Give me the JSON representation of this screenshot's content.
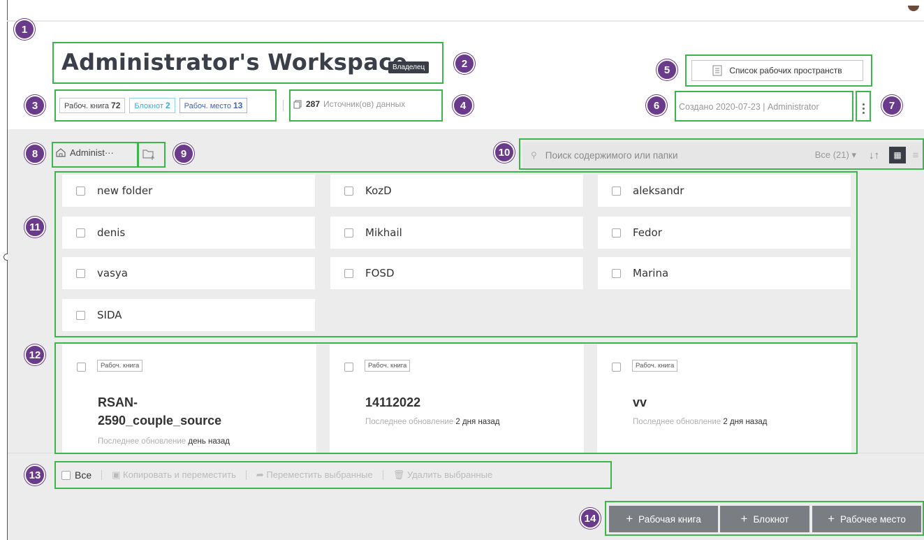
{
  "markers": [
    "1",
    "2",
    "3",
    "4",
    "5",
    "6",
    "7",
    "8",
    "9",
    "10",
    "11",
    "12",
    "13",
    "14"
  ],
  "header": {
    "title": "Administrator's Workspace",
    "owner_badge": "Владелец",
    "counts": [
      {
        "label": "Рабоч. книга",
        "value": "72"
      },
      {
        "label": "Блокнот",
        "value": "2"
      },
      {
        "label": "Рабоч. место",
        "value": "13"
      }
    ],
    "sources_count": "287",
    "sources_label": "Источник(ов) данных",
    "workspace_list_label": "Список рабочих пространств",
    "created_text": "Создано 2020-07-23 | Administrator"
  },
  "toolbar": {
    "breadcrumb": "Administ···",
    "search_placeholder": "Поиск содержимого или папки",
    "filter_label": "Все (21)",
    "filter_caret": "▾",
    "sort_icon": "↓↑",
    "grid_icon": "▦",
    "list_icon": "≡"
  },
  "folders": [
    "new folder",
    "KozD",
    "aleksandr",
    "denis",
    "Mikhail",
    "Fedor",
    "vasya",
    "FOSD",
    "Marina",
    "SIDA"
  ],
  "cards": [
    {
      "type": "Рабоч. книга",
      "name": "RSAN-2590_couple_source",
      "updated_label": "Последнее обновление",
      "updated_value": "день назад"
    },
    {
      "type": "Рабоч. книга",
      "name": "14112022",
      "updated_label": "Последнее обновление",
      "updated_value": "2 дня назад"
    },
    {
      "type": "Рабоч. книга",
      "name": "vv",
      "updated_label": "Последнее обновление",
      "updated_value": "2 дня назад"
    }
  ],
  "bulk_actions": {
    "select_all": "Все",
    "copy_move": "Копировать и переместить",
    "move_selected": "Переместить выбранные",
    "delete_selected": "Удалить выбранные"
  },
  "create_buttons": [
    {
      "label": "Рабочая книга"
    },
    {
      "label": "Блокнот"
    },
    {
      "label": "Рабочее место"
    }
  ],
  "colors": {
    "highlight": "#3cb54a",
    "marker": "#6a3b8a",
    "primary_dark": "#3a3d45",
    "notebook_chip": "#37aee0",
    "workspace_chip": "#3b63c6"
  }
}
